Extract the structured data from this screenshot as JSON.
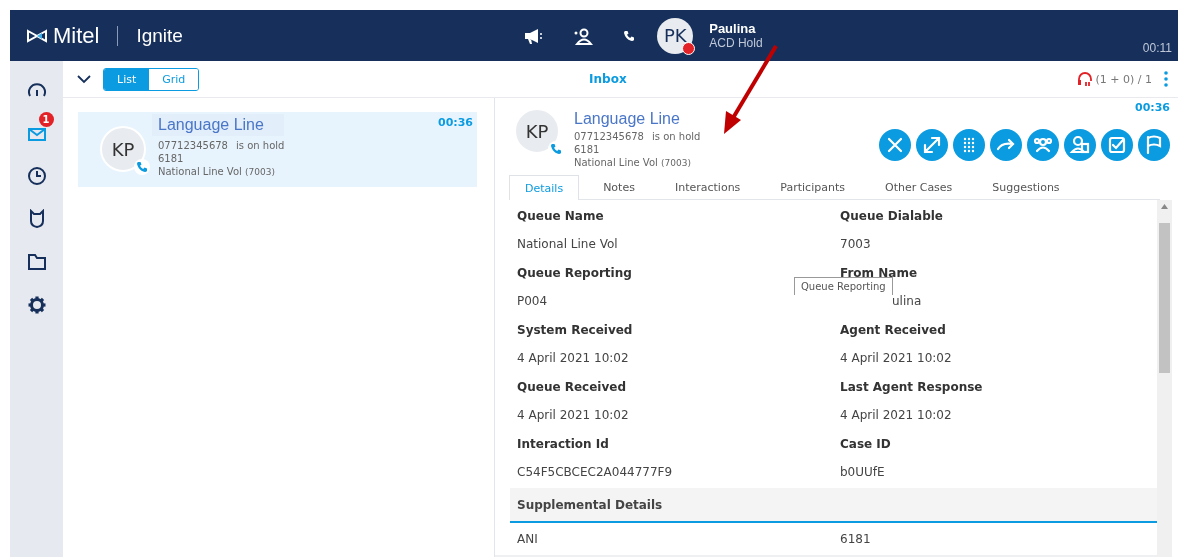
{
  "header": {
    "logo": "Mitel",
    "product": "Ignite",
    "user": {
      "initials": "PK",
      "name": "Paulina",
      "status": "ACD Hold",
      "timer": "00:11"
    }
  },
  "sidebar": {
    "items": [
      {
        "kind": "dashboard",
        "selected": false
      },
      {
        "kind": "inbox",
        "selected": true,
        "badge": "1"
      },
      {
        "kind": "history",
        "selected": false
      },
      {
        "kind": "shield",
        "selected": false
      },
      {
        "kind": "folder",
        "selected": false
      },
      {
        "kind": "settings",
        "selected": false
      }
    ]
  },
  "toolbar": {
    "view_toggle": [
      {
        "label": "List",
        "selected": true
      },
      {
        "label": "Grid",
        "selected": false
      }
    ],
    "title": "Inbox",
    "counter": "(1 + 0) / 1"
  },
  "interactions": [
    {
      "initials": "KP",
      "name": "Language Line",
      "number": "07712345678",
      "status": "is on hold",
      "extension": "6181",
      "queue": "National Line Vol",
      "queue_code": "(7003)",
      "timer": "00:36",
      "selected": true
    }
  ],
  "detail": {
    "initials": "KP",
    "name": "Language Line",
    "number": "07712345678",
    "status": "is on hold",
    "extension": "6181",
    "queue": "National Line Vol",
    "queue_code": "(7003)",
    "timer": "00:36",
    "actions": [
      {
        "kind": "close"
      },
      {
        "kind": "transfer"
      },
      {
        "kind": "keypad"
      },
      {
        "kind": "forward"
      },
      {
        "kind": "conference"
      },
      {
        "kind": "contact"
      },
      {
        "kind": "checkbox"
      },
      {
        "kind": "flag"
      }
    ],
    "tabs": [
      {
        "label": "Details",
        "selected": true
      },
      {
        "label": "Notes",
        "selected": false
      },
      {
        "label": "Interactions",
        "selected": false
      },
      {
        "label": "Participants",
        "selected": false
      },
      {
        "label": "Other Cases",
        "selected": false
      },
      {
        "label": "Suggestions",
        "selected": false
      }
    ],
    "fields": [
      {
        "label": "Queue Name",
        "value": "National Line Vol"
      },
      {
        "label": "Queue Dialable",
        "value": "7003"
      },
      {
        "label": "Queue Reporting",
        "value": "P004"
      },
      {
        "label": "From Name",
        "value": "ulina",
        "tooltip": "Queue Reporting"
      },
      {
        "label": "System Received",
        "value": "4 April 2021 10:02"
      },
      {
        "label": "Agent Received",
        "value": "4 April 2021 10:02"
      },
      {
        "label": "Queue Received",
        "value": "4 April 2021 10:02"
      },
      {
        "label": "Last Agent Response",
        "value": "4 April 2021 10:02"
      },
      {
        "label": "Interaction Id",
        "value": "C54F5CBCEC2A044777F9"
      },
      {
        "label": "Case ID",
        "value": "b0UUfE"
      }
    ],
    "section": "Supplemental Details",
    "supplemental": [
      {
        "label": "ANI",
        "value": "6181"
      }
    ]
  }
}
